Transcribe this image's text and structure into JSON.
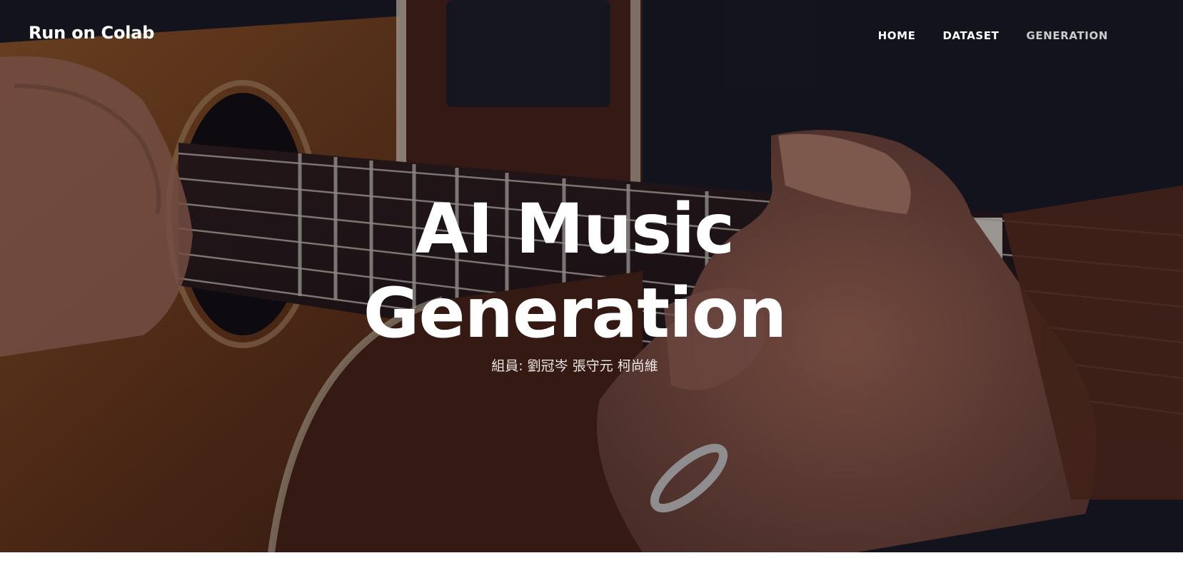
{
  "navbar": {
    "brand": "Run on Colab",
    "links": [
      {
        "label": "HOME"
      },
      {
        "label": "DATASET"
      },
      {
        "label": "GENERATION"
      }
    ]
  },
  "hero": {
    "title_line1": "AI Music",
    "title_line2": "Generation",
    "subtitle": "組員: 劉冠岑 張守元 柯尚維",
    "background": "guitar-photo"
  },
  "colors": {
    "overlay": "#15151f",
    "text": "#ffffff",
    "page_bg": "#ffffff"
  }
}
